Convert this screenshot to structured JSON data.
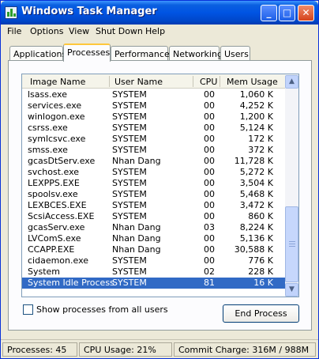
{
  "window": {
    "title": "Windows Task Manager"
  },
  "menu": [
    "File",
    "Options",
    "View",
    "Shut Down",
    "Help"
  ],
  "tabs": [
    {
      "label": "Applications",
      "active": false
    },
    {
      "label": "Processes",
      "active": true
    },
    {
      "label": "Performance",
      "active": false
    },
    {
      "label": "Networking",
      "active": false
    },
    {
      "label": "Users",
      "active": false
    }
  ],
  "columns": {
    "name": "Image Name",
    "user": "User Name",
    "cpu": "CPU",
    "mem": "Mem Usage"
  },
  "processes": [
    {
      "name": "lsass.exe",
      "user": "SYSTEM",
      "cpu": "00",
      "mem": "1,060 K"
    },
    {
      "name": "services.exe",
      "user": "SYSTEM",
      "cpu": "00",
      "mem": "4,252 K"
    },
    {
      "name": "winlogon.exe",
      "user": "SYSTEM",
      "cpu": "00",
      "mem": "1,200 K"
    },
    {
      "name": "csrss.exe",
      "user": "SYSTEM",
      "cpu": "00",
      "mem": "5,124 K"
    },
    {
      "name": "symlcsvc.exe",
      "user": "SYSTEM",
      "cpu": "00",
      "mem": "172 K"
    },
    {
      "name": "smss.exe",
      "user": "SYSTEM",
      "cpu": "00",
      "mem": "372 K"
    },
    {
      "name": "gcasDtServ.exe",
      "user": "Nhan Dang",
      "cpu": "00",
      "mem": "11,728 K"
    },
    {
      "name": "svchost.exe",
      "user": "SYSTEM",
      "cpu": "00",
      "mem": "5,272 K"
    },
    {
      "name": "LEXPPS.EXE",
      "user": "SYSTEM",
      "cpu": "00",
      "mem": "3,504 K"
    },
    {
      "name": "spoolsv.exe",
      "user": "SYSTEM",
      "cpu": "00",
      "mem": "5,468 K"
    },
    {
      "name": "LEXBCES.EXE",
      "user": "SYSTEM",
      "cpu": "00",
      "mem": "3,472 K"
    },
    {
      "name": "ScsiAccess.EXE",
      "user": "SYSTEM",
      "cpu": "00",
      "mem": "860 K"
    },
    {
      "name": "gcasServ.exe",
      "user": "Nhan Dang",
      "cpu": "03",
      "mem": "8,224 K"
    },
    {
      "name": "LVComS.exe",
      "user": "Nhan Dang",
      "cpu": "00",
      "mem": "5,136 K"
    },
    {
      "name": "CCAPP.EXE",
      "user": "Nhan Dang",
      "cpu": "00",
      "mem": "30,588 K"
    },
    {
      "name": "cidaemon.exe",
      "user": "SYSTEM",
      "cpu": "00",
      "mem": "776 K"
    },
    {
      "name": "System",
      "user": "SYSTEM",
      "cpu": "02",
      "mem": "228 K"
    },
    {
      "name": "System Idle Process",
      "user": "SYSTEM",
      "cpu": "81",
      "mem": "16 K",
      "selected": true
    }
  ],
  "show_all_label": "Show processes from all users",
  "end_process_label": "End Process",
  "status": {
    "processes": "Processes: 45",
    "cpu": "CPU Usage: 21%",
    "commit": "Commit Charge: 316M / 988M"
  },
  "colors": {
    "titlebar": "#0054e3",
    "selection": "#316ac5",
    "tab_highlight": "#ffc73c"
  }
}
